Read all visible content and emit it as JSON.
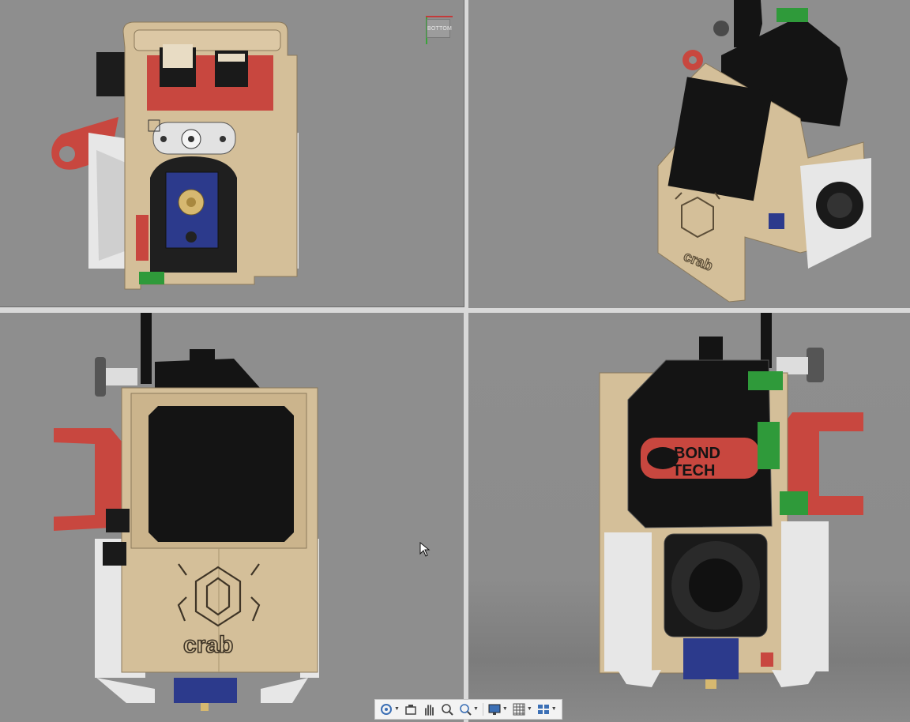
{
  "app": {
    "viewports": [
      {
        "id": "top",
        "cube_label": "BOTTOM"
      },
      {
        "id": "iso"
      },
      {
        "id": "front",
        "logo_text": "crab"
      },
      {
        "id": "back",
        "brand_line1": "BOND",
        "brand_line2": "TECH"
      }
    ]
  },
  "model": {
    "logo_text_top": "crab",
    "logo_text_iso": "crab"
  },
  "colors": {
    "viewport_bg": "#8e8e8e",
    "tan": "#d4bf99",
    "red": "#c8473f",
    "black": "#141414",
    "white_part": "#e7e7e7",
    "blue": "#2c3a8c",
    "green": "#2f9a3a"
  },
  "toolbar": {
    "items": [
      {
        "name": "orbit-icon",
        "has_dropdown": true
      },
      {
        "name": "look-at-icon",
        "has_dropdown": false
      },
      {
        "name": "pan-icon",
        "has_dropdown": false
      },
      {
        "name": "zoom-icon",
        "has_dropdown": false
      },
      {
        "name": "fit-icon",
        "has_dropdown": true
      },
      {
        "name": "display-settings-icon",
        "has_dropdown": true
      },
      {
        "name": "grid-icon",
        "has_dropdown": true
      },
      {
        "name": "viewports-icon",
        "has_dropdown": true
      }
    ]
  }
}
